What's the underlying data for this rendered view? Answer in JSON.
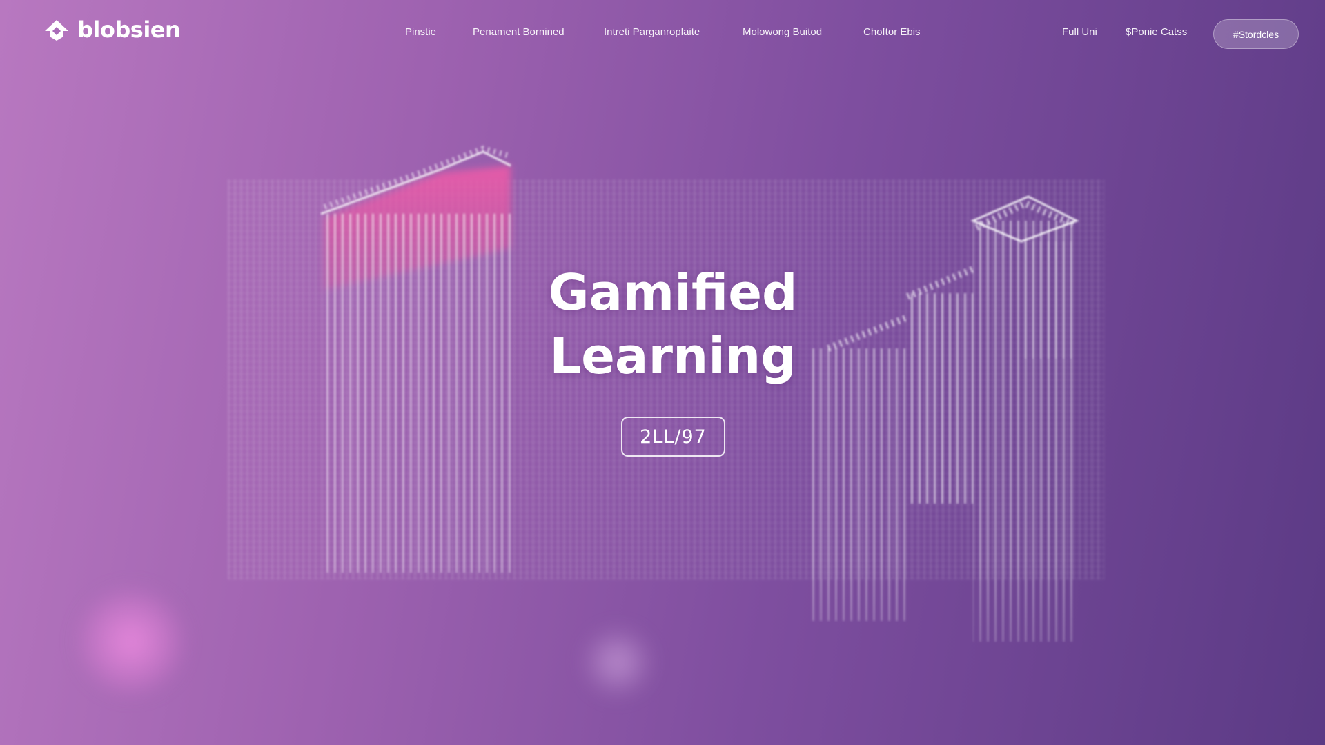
{
  "brand": {
    "name": "blobsien"
  },
  "nav": {
    "links": [
      {
        "label": "Pinstie"
      },
      {
        "label": "Penament Bornined"
      },
      {
        "label": "Intreti Parganroplaite"
      },
      {
        "label": "Molowong Buitod"
      },
      {
        "label": "Choftor Ebis"
      },
      {
        "label": "Full Uni"
      },
      {
        "label": "$Ponie Catss"
      }
    ],
    "cta_label": "#Stordcles"
  },
  "hero": {
    "title_line1": "Gamified",
    "title_line2": "Learning",
    "badge": "2LL/97"
  },
  "colors": {
    "bg_left": "#b878c0",
    "bg_right": "#5b3a85",
    "accent_pink": "#e0559e",
    "text": "#ffffff"
  }
}
